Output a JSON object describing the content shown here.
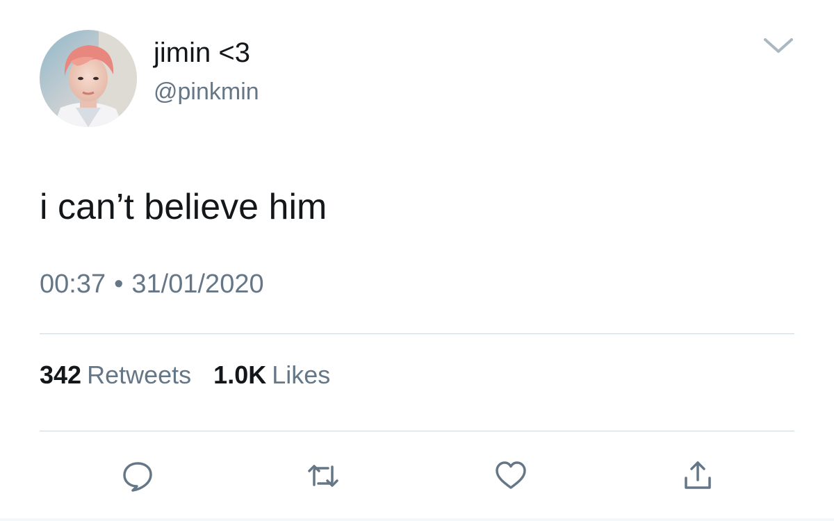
{
  "user": {
    "display_name": "jimin <3",
    "handle": "@pinkmin",
    "avatar_icon": "profile-photo"
  },
  "tweet": {
    "text": "i can’t believe him",
    "time": "00:37",
    "separator": "•",
    "date": "31/01/2020"
  },
  "stats": {
    "retweets_count": "342",
    "retweets_label": "Retweets",
    "likes_count": "1.0K",
    "likes_label": "Likes"
  },
  "actions": [
    {
      "name": "reply",
      "icon": "speech-bubble-icon"
    },
    {
      "name": "retweet",
      "icon": "retweet-arrows-icon"
    },
    {
      "name": "like",
      "icon": "heart-icon"
    },
    {
      "name": "share",
      "icon": "upload-arrow-icon"
    }
  ],
  "colors": {
    "text_primary": "#14171a",
    "text_secondary": "#657786",
    "divider": "#ccd6dd",
    "avatar_hair": "#e8877e"
  }
}
